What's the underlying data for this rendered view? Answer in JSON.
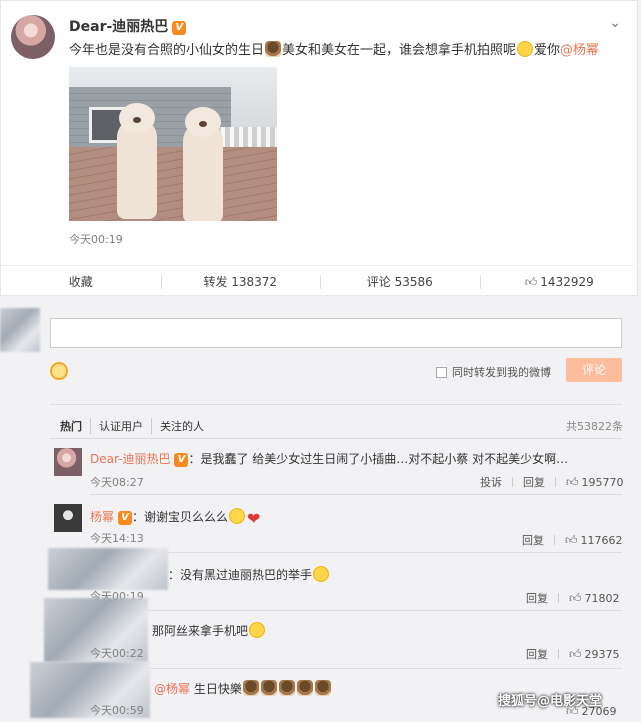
{
  "post": {
    "author": "Dear-迪丽热巴",
    "text_part1": "今年也是没有合照的小仙女的生日",
    "text_part2": "美女和美女在一起，谁会想拿手机拍照呢",
    "text_part3": "爱你",
    "mention": "@杨幂",
    "time": "今天00:19",
    "actions": {
      "collect": "收藏",
      "forward": "转发 138372",
      "comment": "评论 53586",
      "like": "1432929"
    }
  },
  "composer": {
    "forward_label": "同时转发到我的微博",
    "submit_label": "评论"
  },
  "tabs": [
    "热门",
    "认证用户",
    "关注的人"
  ],
  "total": "共53822条",
  "comments": [
    {
      "name": "Dear-迪丽热巴",
      "text": "：是我蠢了 给美少女过生日闹了小插曲…对不起小蔡 对不起美少女啊…",
      "time": "今天08:27",
      "report": "投诉",
      "reply": "回复",
      "likes": "195770"
    },
    {
      "name": "杨幂",
      "text": "：谢谢宝贝么么么",
      "time": "今天14:13",
      "reply": "回复",
      "likes": "117662"
    },
    {
      "text": "：没有黑过迪丽热巴的举手",
      "time": "今天00:19",
      "reply": "回复",
      "likes": "71802"
    },
    {
      "text": "那阿丝来拿手机吧",
      "time": "今天00:22",
      "reply": "回复",
      "likes": "29375"
    },
    {
      "mention": "@杨幂",
      "text": " 生日快樂",
      "time": "今天00:59",
      "likes": "27069"
    }
  ],
  "watermark": "搜狐号@电影天堂",
  "colors": {
    "accent": "#eb7350",
    "vip_badge": "#f78b1f",
    "submit_bg": "#fdbd9c"
  }
}
